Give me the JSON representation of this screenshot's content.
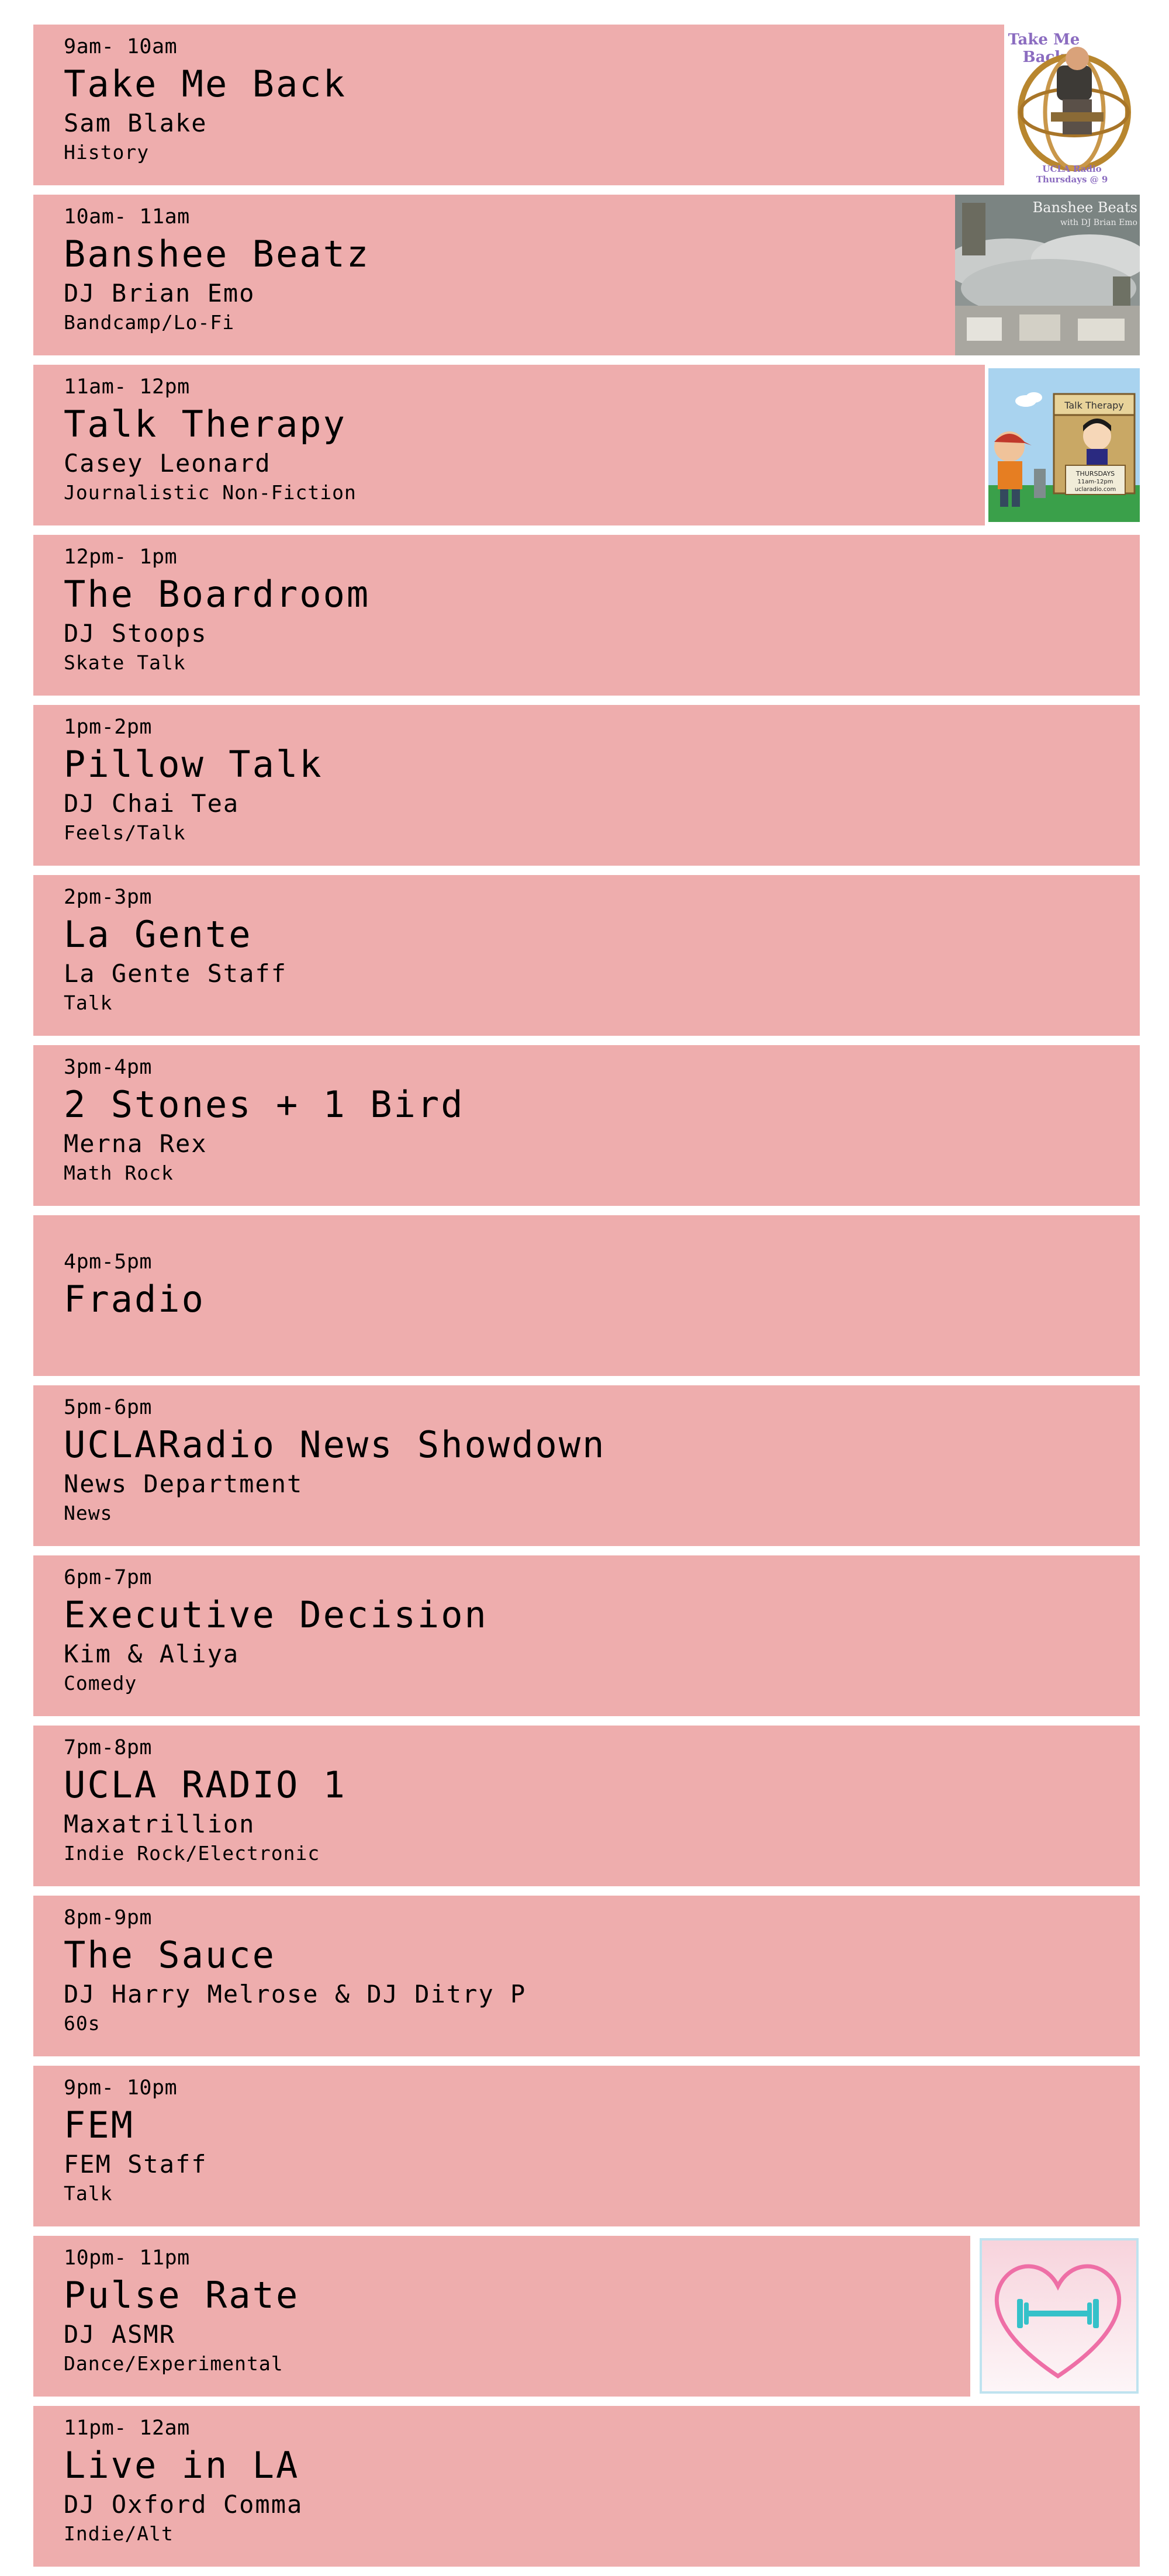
{
  "colors": {
    "card_background": "#eeadad",
    "page_background": "#ffffff",
    "text": "#000000"
  },
  "schedule": [
    {
      "time": "9am- 10am",
      "title": "Take Me Back",
      "host": "Sam Blake",
      "genre": "History",
      "art": {
        "name": "take-me-back-artwork",
        "text_top": "Take Me",
        "text_mid": "Back",
        "text_bottom1": "UCLA Radio",
        "text_bottom2": "Thursdays @ 9"
      }
    },
    {
      "time": "10am- 11am",
      "title": "Banshee Beatz",
      "host": "DJ Brian Emo",
      "genre": "Bandcamp/Lo-Fi",
      "art": {
        "name": "banshee-beats-artwork",
        "text_top": "Banshee Beats",
        "text_sub": "with DJ Brian Emo"
      }
    },
    {
      "time": "11am- 12pm",
      "title": "Talk Therapy",
      "host": "Casey Leonard",
      "genre": "Journalistic Non-Fiction",
      "art": {
        "name": "talk-therapy-artwork",
        "sign": "Talk Therapy",
        "board1": "THURSDAYS",
        "board2": "11am-12pm",
        "board3": "uclaradio.com"
      }
    },
    {
      "time": "12pm- 1pm",
      "title": "The Boardroom",
      "host": "DJ Stoops",
      "genre": "Skate Talk"
    },
    {
      "time": "1pm-2pm",
      "title": "Pillow Talk",
      "host": "DJ Chai Tea",
      "genre": "Feels/Talk"
    },
    {
      "time": "2pm-3pm",
      "title": "La Gente",
      "host": "La Gente Staff",
      "genre": "Talk"
    },
    {
      "time": "3pm-4pm",
      "title": "2 Stones + 1 Bird",
      "host": "Merna Rex",
      "genre": "Math Rock"
    },
    {
      "time": "4pm-5pm",
      "title": "Fradio",
      "host": "",
      "genre": ""
    },
    {
      "time": "5pm-6pm",
      "title": "UCLARadio News Showdown",
      "host": "News Department",
      "genre": "News"
    },
    {
      "time": "6pm-7pm",
      "title": "Executive Decision",
      "host": "Kim & Aliya",
      "genre": "Comedy"
    },
    {
      "time": "7pm-8pm",
      "title": "UCLA RADIO 1",
      "host": "Maxatrillion",
      "genre": "Indie Rock/Electronic"
    },
    {
      "time": "8pm-9pm",
      "title": "The Sauce",
      "host": "DJ Harry Melrose & DJ Ditry P",
      "genre": "60s"
    },
    {
      "time": "9pm- 10pm",
      "title": "FEM",
      "host": "FEM Staff",
      "genre": "Talk"
    },
    {
      "time": "10pm- 11pm",
      "title": "Pulse Rate",
      "host": "DJ ASMR",
      "genre": "Dance/Experimental",
      "art": {
        "name": "pulse-rate-artwork"
      }
    },
    {
      "time": "11pm- 12am",
      "title": "Live in LA",
      "host": "DJ Oxford Comma",
      "genre": "Indie/Alt"
    }
  ]
}
